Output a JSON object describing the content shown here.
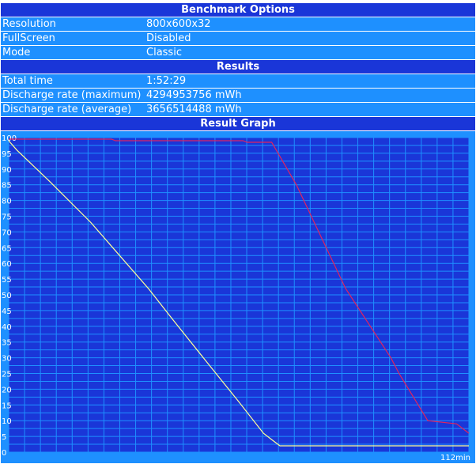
{
  "benchmark_options": {
    "title": "Benchmark Options",
    "rows": [
      {
        "label": "Resolution",
        "value": "800x600x32"
      },
      {
        "label": "FullScreen",
        "value": "Disabled"
      },
      {
        "label": "Mode",
        "value": "Classic"
      }
    ]
  },
  "results": {
    "title": "Results",
    "rows": [
      {
        "label": "Total time",
        "value": "1:52:29"
      },
      {
        "label": "Discharge rate (maximum)",
        "value": "4294953756 mWh"
      },
      {
        "label": "Discharge rate (average)",
        "value": "3656514488 mWh"
      }
    ]
  },
  "result_graph": {
    "title": "Result Graph"
  },
  "colors": {
    "header_bg": "#1a36d8",
    "row_bg": "#1e90ff",
    "plot_bg": "#1a36d8",
    "grid": "#1e90ff",
    "series_a": "#ffff99",
    "series_b": "#e0245e"
  },
  "chart_data": {
    "type": "line",
    "title": "",
    "xlabel": "112min",
    "ylabel": "",
    "xlim": [
      0,
      112
    ],
    "ylim": [
      0,
      100
    ],
    "y_ticks": [
      "0",
      "5",
      "10",
      "15",
      "20",
      "25",
      "30",
      "35",
      "40",
      "45",
      "50",
      "55",
      "60",
      "65",
      "70",
      "75",
      "80",
      "85",
      "90",
      "95",
      "100"
    ],
    "grid": true,
    "series": [
      {
        "x": [
          0,
          2,
          10,
          20,
          26,
          34,
          40,
          48,
          56,
          62,
          64,
          66,
          112
        ],
        "y": [
          99,
          96,
          86,
          73,
          64,
          52,
          42,
          29,
          16,
          6,
          4,
          2,
          2
        ]
      },
      {
        "x": [
          0,
          25,
          26,
          57,
          58,
          63,
          64,
          70,
          82,
          93,
          95,
          102,
          109,
          112
        ],
        "y": [
          99.5,
          99.5,
          99,
          99,
          98.5,
          98.5,
          98.5,
          85,
          52,
          30,
          25,
          10,
          9,
          6
        ]
      }
    ]
  }
}
